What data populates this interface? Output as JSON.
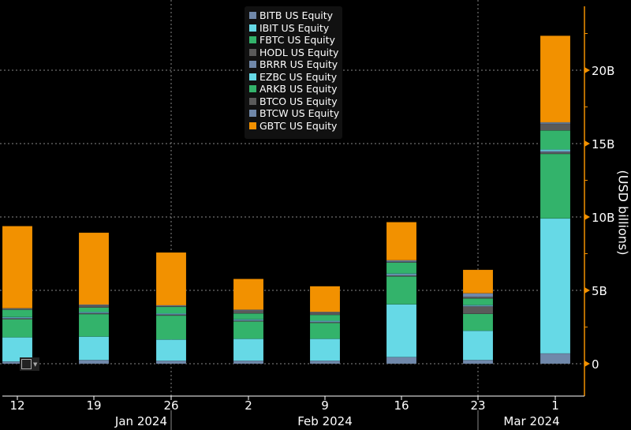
{
  "chart_data": {
    "type": "bar",
    "stacked": true,
    "categories": [
      "12",
      "19",
      "26",
      "2",
      "9",
      "16",
      "23",
      "1"
    ],
    "month_labels": [
      "Jan 2024",
      "Feb 2024",
      "Mar 2024"
    ],
    "ylabel": "(USD billions)",
    "ylim": [
      0,
      24
    ],
    "yticks": [
      0,
      5,
      10,
      15,
      20
    ],
    "ytick_labels": [
      "0",
      "5B",
      "10B",
      "15B",
      "20B"
    ],
    "y_axis_side": "right",
    "grid": true,
    "legend_placement": "top-center",
    "series": [
      {
        "name": "BITB US Equity",
        "color": "#7088aa",
        "values": [
          0.15,
          0.25,
          0.2,
          0.2,
          0.2,
          0.45,
          0.25,
          0.7
        ]
      },
      {
        "name": "IBIT US Equity",
        "color": "#66d9e6",
        "values": [
          1.65,
          1.6,
          1.45,
          1.5,
          1.5,
          3.6,
          2.0,
          9.2
        ]
      },
      {
        "name": "FBTC US Equity",
        "color": "#33b36b",
        "values": [
          1.25,
          1.55,
          1.65,
          1.2,
          1.1,
          1.9,
          1.15,
          4.4
        ]
      },
      {
        "name": "HODL US Equity",
        "color": "#5a5a5a",
        "values": [
          0.03,
          0.03,
          0.03,
          0.03,
          0.03,
          0.05,
          0.5,
          0.1
        ]
      },
      {
        "name": "BRRR US Equity",
        "color": "#7088aa",
        "values": [
          0.05,
          0.05,
          0.05,
          0.05,
          0.05,
          0.1,
          0.05,
          0.1
        ]
      },
      {
        "name": "EZBC US Equity",
        "color": "#66d9e6",
        "values": [
          0.05,
          0.05,
          0.05,
          0.05,
          0.05,
          0.05,
          0.05,
          0.1
        ]
      },
      {
        "name": "ARKB US Equity",
        "color": "#33b36b",
        "values": [
          0.5,
          0.3,
          0.45,
          0.4,
          0.4,
          0.75,
          0.45,
          1.3
        ]
      },
      {
        "name": "BTCO US Equity",
        "color": "#5a5a5a",
        "values": [
          0.05,
          0.15,
          0.05,
          0.2,
          0.15,
          0.05,
          0.1,
          0.45
        ]
      },
      {
        "name": "BTCW US Equity",
        "color": "#7088aa",
        "values": [
          0.05,
          0.05,
          0.05,
          0.05,
          0.05,
          0.1,
          0.25,
          0.1
        ]
      },
      {
        "name": "GBTC US Equity",
        "color": "#f29100",
        "values": [
          5.6,
          4.9,
          3.6,
          2.1,
          1.75,
          2.6,
          1.6,
          5.9
        ]
      }
    ]
  },
  "colors": {
    "axis": "#f29100",
    "grid": "#888888",
    "background": "#000000"
  },
  "icons": {
    "chart_widget": "line-chart-icon"
  }
}
